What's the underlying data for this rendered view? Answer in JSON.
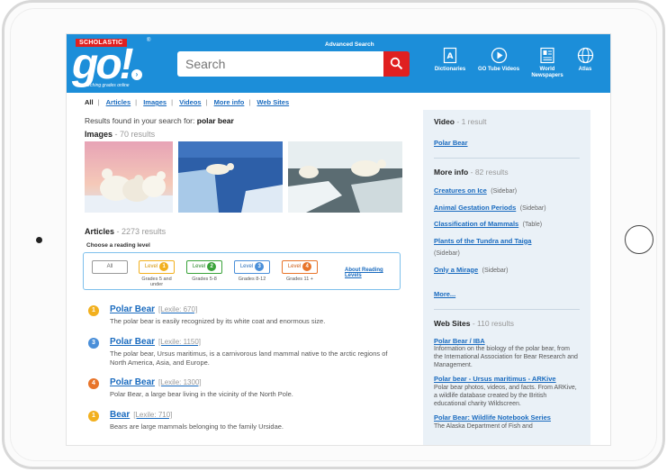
{
  "header": {
    "logo_tag": "SCHOLASTIC",
    "logo": "go!",
    "tagline": "researching grades online",
    "advanced_search": "Advanced Search",
    "search_placeholder": "Search",
    "tools": [
      {
        "icon": "dictionary-icon",
        "label": "Dictionaries"
      },
      {
        "icon": "play-video-icon",
        "label": "GO Tube Videos"
      },
      {
        "icon": "newspaper-icon",
        "label": "World Newspapers"
      },
      {
        "icon": "globe-icon",
        "label": "Atlas"
      }
    ]
  },
  "filters": {
    "all": "All",
    "articles": "Articles",
    "images": "Images",
    "videos": "Videos",
    "more_info": "More info",
    "web_sites": "Web Sites"
  },
  "results_for": {
    "prefix": "Results found in your search for:",
    "query": "polar bear"
  },
  "images": {
    "heading": "Images",
    "count": "- 70 results"
  },
  "articles": {
    "heading": "Articles",
    "count": "- 2273 results",
    "choose_level": "Choose a reading level",
    "levels": [
      {
        "label": "All",
        "sub": "",
        "num": ""
      },
      {
        "label": "Level",
        "num": "1",
        "sub": "Grades 5 and under"
      },
      {
        "label": "Level",
        "num": "2",
        "sub": "Grades 5-8"
      },
      {
        "label": "Level",
        "num": "3",
        "sub": "Grades 8-12"
      },
      {
        "label": "Level",
        "num": "4",
        "sub": "Grades 11 +"
      }
    ],
    "about_levels": "About Reading Levels",
    "items": [
      {
        "num": "1",
        "title": "Polar Bear",
        "lexile": "[Lexile: 670]",
        "desc": "The polar bear is easily recognized by its white coat and enormous size."
      },
      {
        "num": "3",
        "title": "Polar Bear",
        "lexile": "[Lexile: 1150]",
        "desc": "The polar bear, Ursus maritimus, is a carnivorous land mammal native to the arctic regions of North America, Asia, and Europe."
      },
      {
        "num": "4",
        "title": "Polar Bear",
        "lexile": "[Lexile: 1300]",
        "desc": "Polar Bear, a large bear living in the vicinity of the North Pole."
      },
      {
        "num": "1",
        "title": "Bear",
        "lexile": "[Lexile: 710]",
        "desc": "Bears are large mammals belonging to the family Ursidae."
      }
    ]
  },
  "sidebar": {
    "video": {
      "heading": "Video",
      "count": "- 1 result",
      "link": "Polar Bear"
    },
    "more_info": {
      "heading": "More info",
      "count": "- 82 results",
      "items": [
        {
          "title": "Creatures on Ice",
          "note": "(Sidebar)"
        },
        {
          "title": "Animal Gestation Periods",
          "note": "(Sidebar)"
        },
        {
          "title": "Classification of Mammals",
          "note": "(Table)"
        },
        {
          "title": "Plants of the Tundra and Taiga",
          "note": "(Sidebar)"
        },
        {
          "title": "Only a Mirage",
          "note": "(Sidebar)"
        }
      ],
      "more": "More..."
    },
    "web_sites": {
      "heading": "Web Sites",
      "count": "- 110 results",
      "items": [
        {
          "title": "Polar Bear / IBA",
          "desc": "Information on the biology of the polar bear, from the International Association for Bear Research and Management."
        },
        {
          "title": "Polar bear - Ursus maritimus - ARKive",
          "desc": "Polar bear photos, videos, and facts. From ARKive, a wildlife database created by the British educational charity Wildscreen."
        },
        {
          "title": "Polar Bear: Wildlife Notebook Series",
          "desc": "The Alaska Department of Fish and"
        }
      ]
    }
  },
  "colors": {
    "brand_blue": "#1c8ed9",
    "search_red": "#e02020",
    "link_blue": "#1a6bbf",
    "level1": "#f2b01e",
    "level2": "#3aa33a",
    "level3": "#4a8fd9",
    "level4": "#e8742a"
  }
}
